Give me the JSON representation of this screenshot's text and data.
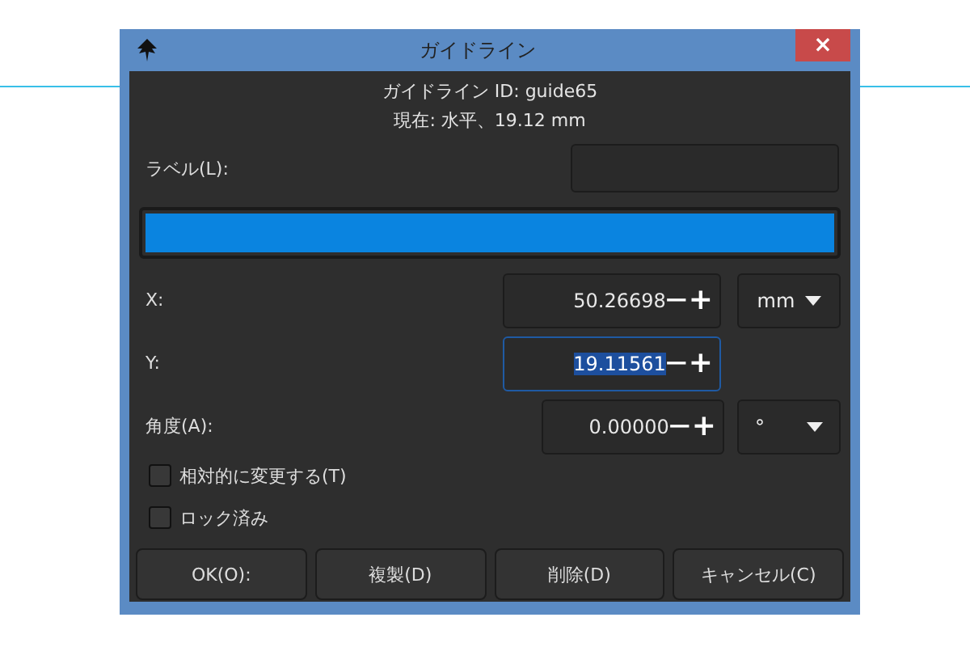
{
  "window": {
    "title": "ガイドライン",
    "close": "×"
  },
  "info": [
    "ガイドライン ID: guide65",
    "現在: 水平、19.12 mm"
  ],
  "label_field": {
    "label": "ラベル(L):"
  },
  "color_swatch": {
    "color": "#0a84e0"
  },
  "coordinates": [
    {
      "label": "X:",
      "value": "50.26698",
      "focused": false,
      "unit": "mm"
    },
    {
      "label": "Y:",
      "value": "19.11561",
      "focused": true
    },
    {
      "label": "角度(A):",
      "value": "0.00000",
      "focused": false,
      "unit": "°"
    }
  ],
  "spin_symbols": {
    "minus": "—",
    "plus": "+"
  },
  "checkboxes": [
    {
      "label": "相対的に変更する(T)",
      "checked": false
    },
    {
      "label": "ロック済み",
      "checked": false
    }
  ],
  "buttons": [
    "OK(O):",
    "複製(D)",
    "削除(D)",
    "キャンセル(C)"
  ]
}
